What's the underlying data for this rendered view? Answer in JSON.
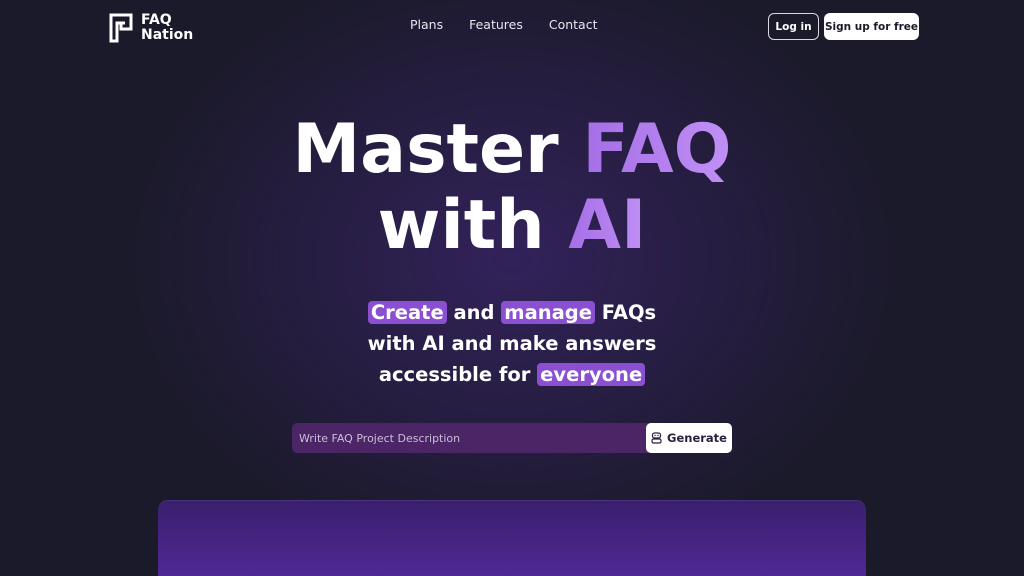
{
  "brand": {
    "name_line1": "FAQ",
    "name_line2": "Nation"
  },
  "nav": {
    "links": [
      "Plans",
      "Features",
      "Contact"
    ],
    "login_label": "Log in",
    "signup_label": "Sign up for free"
  },
  "hero": {
    "title_part1": "Master ",
    "title_accent1": "FAQ",
    "title_part2": "with ",
    "title_accent2": "AI",
    "sub_hl1": "Create",
    "sub_t1": " and ",
    "sub_hl2": "manage",
    "sub_t2": " FAQs",
    "sub_line2": "with AI and make answers",
    "sub_t3": "accessible for ",
    "sub_hl3": "everyone"
  },
  "search": {
    "placeholder": "Write FAQ Project Description",
    "value": "",
    "generate_label": "Generate",
    "generate_icon": "robot-icon"
  },
  "colors": {
    "background": "#1b1a2b",
    "accent": "#b27bee",
    "highlight": "#8b4fd1",
    "input_bg": "#4b2566"
  }
}
